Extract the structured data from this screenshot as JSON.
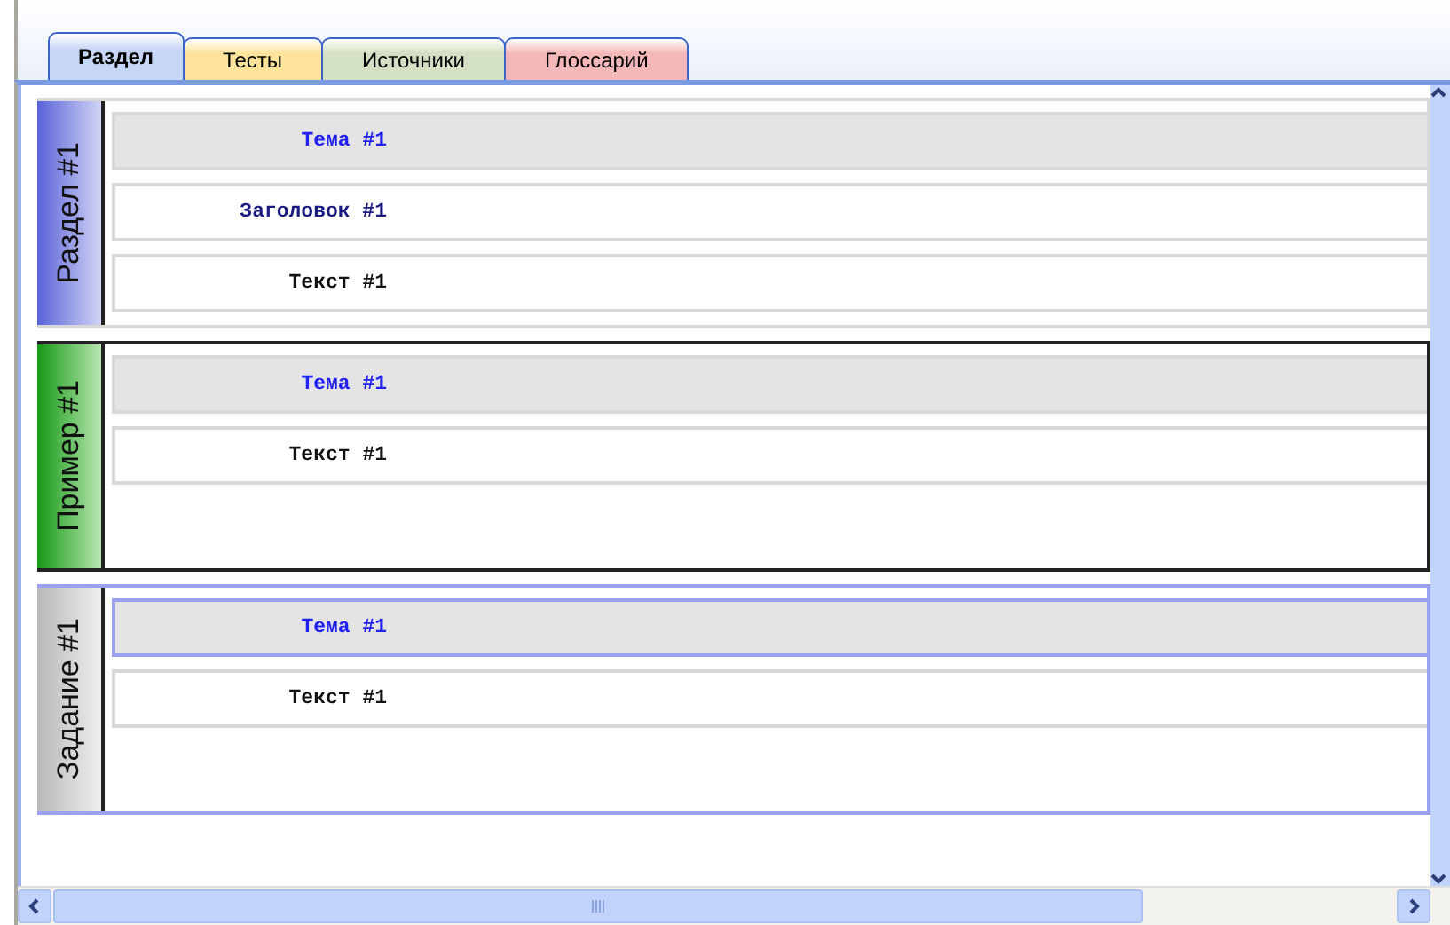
{
  "tabs": [
    {
      "label": "Раздел",
      "selected": true,
      "color": "#c6d6f5"
    },
    {
      "label": "Тесты",
      "selected": false,
      "color": "#fde49a"
    },
    {
      "label": "Источники",
      "selected": false,
      "color": "#d3e0c4"
    },
    {
      "label": "Глоссарий",
      "selected": false,
      "color": "#f5b8b8"
    }
  ],
  "sections": [
    {
      "kind": "chapter",
      "label": "Раздел #1",
      "rows": [
        {
          "kind": "topic",
          "text": "Тема #1",
          "selected": false
        },
        {
          "kind": "heading",
          "text": "Заголовок #1",
          "selected": false
        },
        {
          "kind": "text",
          "text": "Текст #1",
          "selected": false
        }
      ]
    },
    {
      "kind": "example",
      "label": "Пример #1",
      "rows": [
        {
          "kind": "topic",
          "text": "Тема #1",
          "selected": false
        },
        {
          "kind": "text",
          "text": "Текст #1",
          "selected": false
        }
      ]
    },
    {
      "kind": "task",
      "label": "Задание #1",
      "rows": [
        {
          "kind": "topic",
          "text": "Тема #1",
          "selected": true
        },
        {
          "kind": "text",
          "text": "Текст #1",
          "selected": false
        }
      ]
    }
  ]
}
